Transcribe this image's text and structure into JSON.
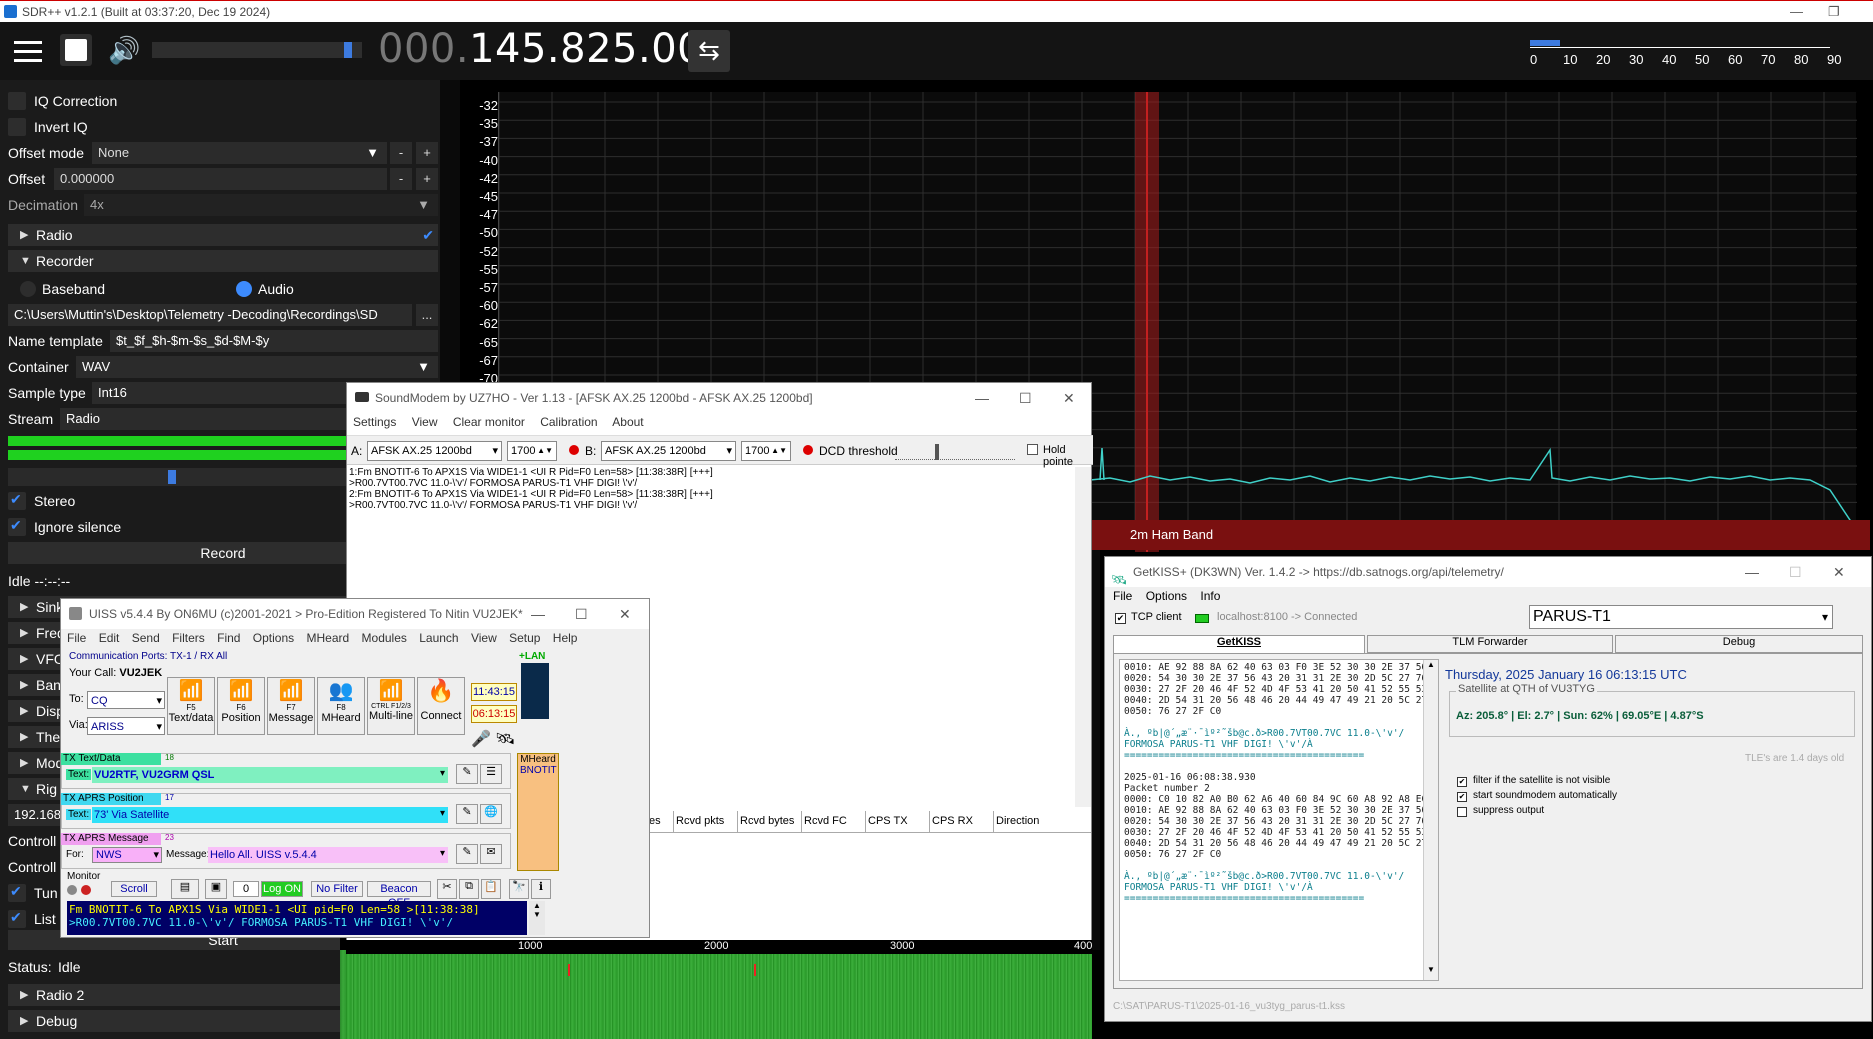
{
  "sdr": {
    "title": "SDR++ v1.2.1 (Built at 03:37:20, Dec 19 2024)",
    "frequency_dim": "000.",
    "frequency": "145.825.000",
    "snr_scale": [
      "0",
      "10",
      "20",
      "30",
      "40",
      "50",
      "60",
      "70",
      "80",
      "90"
    ],
    "y_axis": [
      "-32",
      "-35",
      "-37",
      "-40",
      "-42",
      "-45",
      "-47",
      "-50",
      "-52",
      "-55",
      "-57",
      "-60",
      "-62",
      "-65",
      "-67",
      "-70"
    ],
    "band_label": "2m Ham Band",
    "left": {
      "iq_correction": "IQ Correction",
      "invert_iq": "Invert IQ",
      "offset_mode_label": "Offset mode",
      "offset_mode_value": "None",
      "offset_label": "Offset",
      "offset_value": "0.000000",
      "decimation_label": "Decimation",
      "decimation_value": "4x",
      "radio": "Radio",
      "recorder": "Recorder",
      "baseband": "Baseband",
      "audio": "Audio",
      "path": "C:\\Users\\Muttin's\\Desktop\\Telemetry -Decoding\\Recordings\\SD",
      "path_btn": "...",
      "name_template_label": "Name template",
      "name_template_value": "$t_$f_$h-$m-$s_$d-$M-$y",
      "container_label": "Container",
      "container_value": "WAV",
      "sample_type_label": "Sample type",
      "sample_type_value": "Int16",
      "stream_label": "Stream",
      "stream_value": "Radio",
      "stereo": "Stereo",
      "ignore_silence": "Ignore silence",
      "record": "Record",
      "idle": "Idle --:--:--",
      "sink": "Sink",
      "freq_mgr": "Freq",
      "vfo": "VFO",
      "band": "Ban",
      "display": "Disp",
      "theme": "The",
      "module": "Mod",
      "rig": "Rig",
      "ip": "192.168",
      "control1": "Controll",
      "control2": "Controll",
      "tuning": "Tun",
      "listen": "List",
      "start": "Start",
      "status_label": "Status:",
      "status_value": "Idle",
      "radio2": "Radio 2",
      "debug": "Debug"
    }
  },
  "soundmodem": {
    "title": "SoundModem by UZ7HO - Ver 1.13 - [AFSK AX.25 1200bd - AFSK AX.25 1200bd]",
    "menu": [
      "Settings",
      "View",
      "Clear monitor",
      "Calibration",
      "About"
    ],
    "a_label": "A:",
    "a_mode": "AFSK AX.25 1200bd",
    "a_freq": "1700",
    "b_label": "B:",
    "b_mode": "AFSK AX.25 1200bd",
    "b_freq": "1700",
    "dcd_label": "DCD threshold",
    "hold_label": "Hold pointe",
    "log": [
      "1:Fm BNOTIT-6 To APX1S Via WIDE1-1 <UI R Pid=F0 Len=58> [11:38:38R] [+++]",
      ">R00.7VT00.7VC 11.0-\\'v'/ FORMOSA PARUS-T1 VHF DIGI! \\'v'/",
      "2:Fm BNOTIT-6 To APX1S Via WIDE1-1 <UI R Pid=F0 Len=58> [11:38:38R] [+++]",
      ">R00.7VT00.7VC 11.0-\\'v'/ FORMOSA PARUS-T1 VHF DIGI! \\'v'/"
    ],
    "columns": [
      "es",
      "Rcvd pkts",
      "Rcvd bytes",
      "Rcvd FC",
      "CPS TX",
      "CPS RX",
      "Direction"
    ],
    "scale": [
      "1000",
      "2000",
      "3000",
      "400"
    ]
  },
  "uiss": {
    "title": "UISS v5.4.4 By ON6MU (c)2001-2021 > Pro-Edition Registered To Nitin VU2JEK*",
    "menu": [
      "File",
      "Edit",
      "Send",
      "Filters",
      "Find",
      "Options",
      "MHeard",
      "Modules",
      "Launch",
      "View",
      "Setup",
      "Help"
    ],
    "ports": "Communication Ports: TX-1 / RX All",
    "your_call_label": "Your Call:",
    "your_call": "VU2JEK",
    "to_label": "To:",
    "to_value": "CQ",
    "via_label": "Via:",
    "via_value": "ARISS",
    "buttons": [
      "Text/data",
      "Position",
      "Message",
      "MHeard",
      "Multi-line",
      "Connect"
    ],
    "fkeys": [
      "F5",
      "F6",
      "F7",
      "F8",
      "CTRL F1/2/3"
    ],
    "time1": "11:43:15",
    "time2": "06:13:15",
    "lan": "+LAN",
    "tx_text_label": "TX Text/Data",
    "text_label": "Text:",
    "tx_text": "VU2RTF, VU2GRM QSL",
    "tx_text_num": "18",
    "tx_pos_label": "TX APRS Position",
    "tx_pos": "73' Via Satellite",
    "tx_pos_num": "17",
    "tx_msg_label": "TX APRS Message",
    "tx_msg_num": "23",
    "for_label": "For:",
    "for_value": "NWS",
    "message_label": "Message:",
    "message_value": "Hello All. UISS v.5.4.4",
    "mheard_label": "MHeard",
    "mheard_item": "BNOTIT",
    "monitor_label": "Monitor",
    "scroll": "Scroll",
    "zero": "0",
    "log_on": "Log ON",
    "no_filter": "No Filter",
    "beacon_off": "Beacon OFF",
    "monitor_line1": "Fm BNOTIT-6 To APX1S Via WIDE1-1 <UI pid=F0 Len=58 >[11:38:38]",
    "monitor_line2": ">R00.7VT00.7VC 11.0-\\'v'/ FORMOSA PARUS-T1 VHF DIGI! \\'v'/"
  },
  "getkiss": {
    "title": "GetKISS+ (DK3WN) Ver. 1.4.2 -> https://db.satnogs.org/api/telemetry/",
    "menu": [
      "File",
      "Options",
      "Info"
    ],
    "tcp_label": "TCP client",
    "tcp_status": "localhost:8100 -> Connected",
    "satellite": "PARUS-T1",
    "tabs": [
      "GetKISS",
      "TLM Forwarder",
      "Debug"
    ],
    "hex_block1": [
      "0010: AE 92 88 8A 62 40 63 03 F0 3E 52 30 30 2E 37 56",
      "0020: 54 30 30 2E 37 56 43 20 31 31 2E 30 2D 5C 27 76",
      "0030: 27 2F 20 46 4F 52 4D 4F 53 41 20 50 41 52 55 53",
      "0040: 2D 54 31 20 56 48 46 20 44 49 47 49 21 20 5C 27",
      "0050: 76 27 2F C0"
    ],
    "decoded1": "À., ºb|@´„æ¨·¯ìº²˜šb@c.ð>R00.7VT00.7VC 11.0-\\'v'/ FORMOSA PARUS-T1 VHF DIGI! \\'v'/À",
    "separator": "==========================================",
    "timestamp2": "2025-01-16 06:08:38.930",
    "packet_number": "Packet number 2",
    "hex_block2": [
      "0000: C0 10 82 A0 B0 62 A6 40 60 84 9C 60 A8 92 A8 EC",
      "0010: AE 92 88 8A 62 40 63 03 F0 3E 52 30 30 2E 37 56",
      "0020: 54 30 30 2E 37 56 43 20 31 31 2E 30 2D 5C 27 76",
      "0030: 27 2F 20 46 4F 52 4D 4F 53 41 20 50 41 52 55 53",
      "0040: 2D 54 31 20 56 48 46 20 44 49 47 49 21 20 5C 27",
      "0050: 76 27 2F C0"
    ],
    "decoded2": "À., ºb|@´„æ¨·¯ìº²˜šb@c.ð>R00.7VT00.7VC 11.0-\\'v'/ FORMOSA PARUS-T1 VHF DIGI! \\'v'/À",
    "date": "Thursday, 2025 January 16  06:13:15 UTC",
    "qth_label": "Satellite at QTH of VU3TYG",
    "qth_value": "Az: 205.8° | El: 2.7° | Sun: 62% | 69.05°E | 4.87°S",
    "tle": "TLE's are 1.4 days old",
    "opt1": "filter if the satellite is not visible",
    "opt2": "start soundmodem automatically",
    "opt3": "suppress output",
    "footer": "C:\\SAT\\PARUS-T1\\2025-01-16_vu3tyg_parus-t1.kss"
  }
}
